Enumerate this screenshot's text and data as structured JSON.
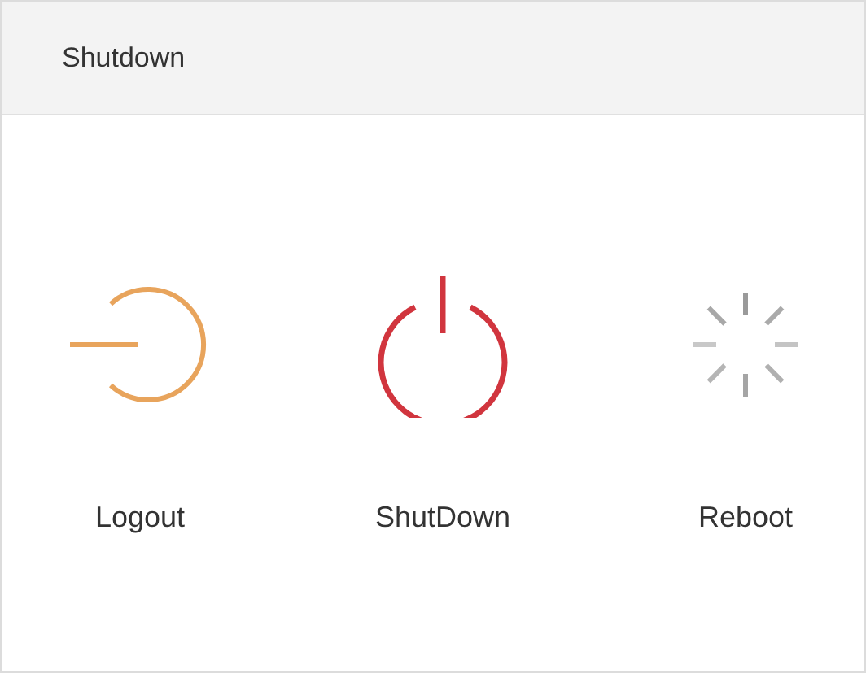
{
  "window": {
    "title": "Shutdown"
  },
  "actions": [
    {
      "kind": "logout",
      "label": "Logout"
    },
    {
      "kind": "shutdown",
      "label": "ShutDown"
    },
    {
      "kind": "reboot",
      "label": "Reboot"
    }
  ]
}
